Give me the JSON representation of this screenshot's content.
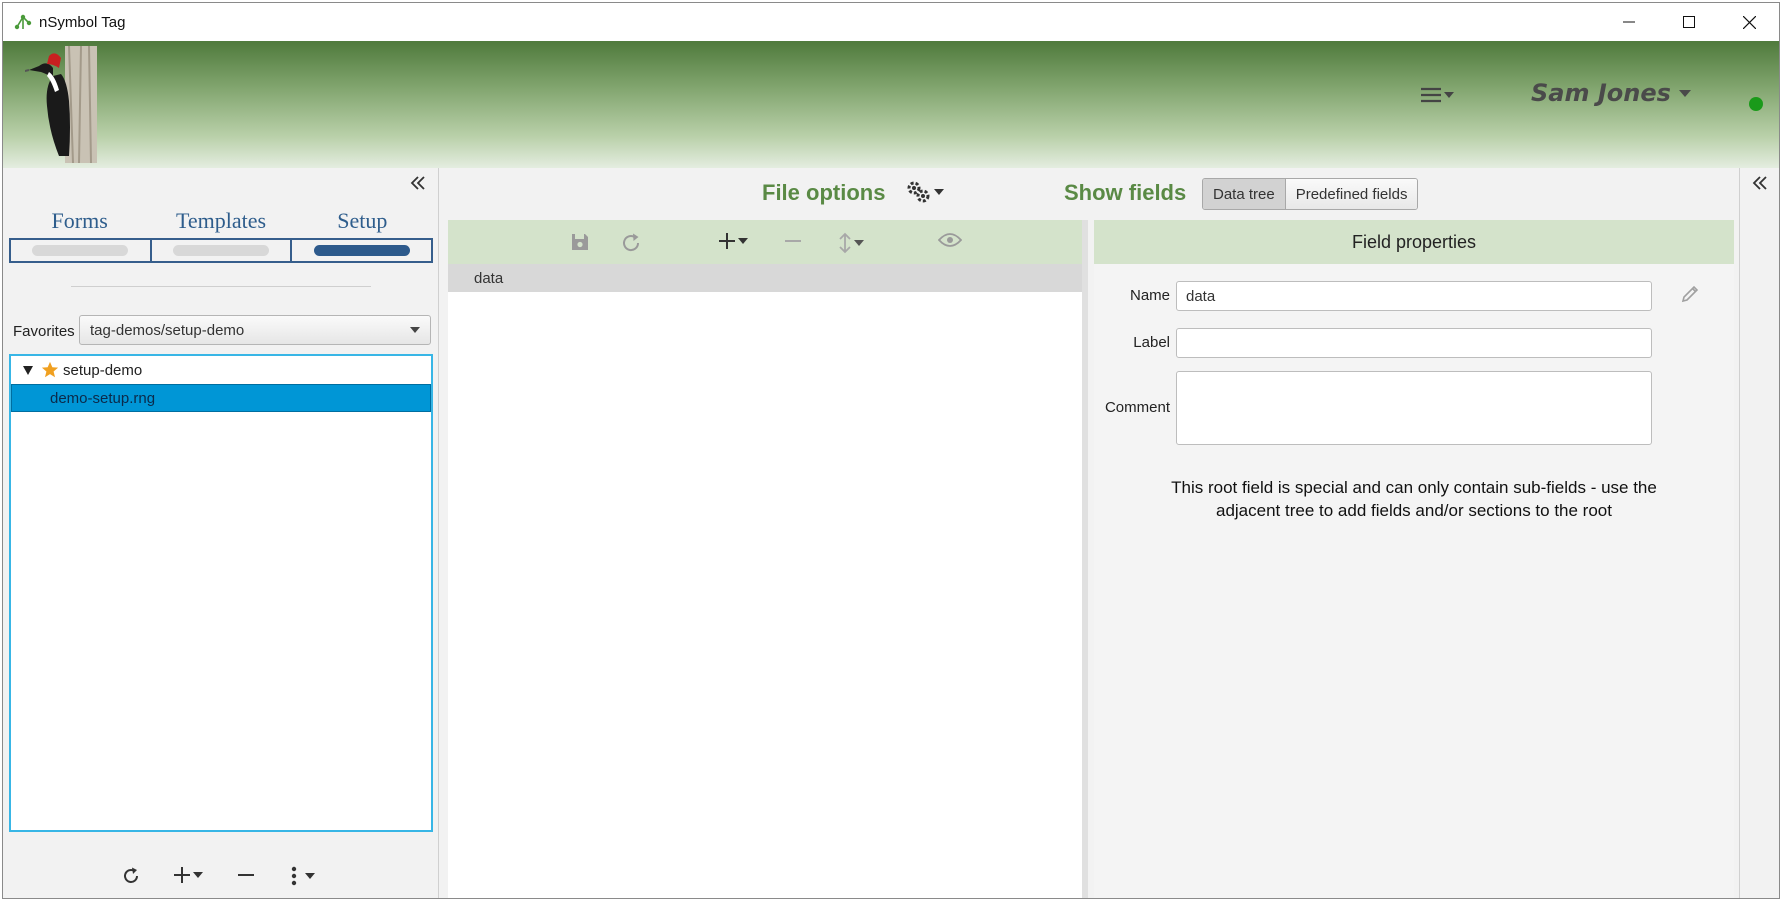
{
  "window": {
    "title": "nSymbol Tag"
  },
  "banner": {
    "user_name": "Sam Jones"
  },
  "left_panel": {
    "tabs": [
      {
        "label": "Forms",
        "active": false
      },
      {
        "label": "Templates",
        "active": false
      },
      {
        "label": "Setup",
        "active": true
      }
    ],
    "favorites_label": "Favorites",
    "favorites_value": "tag-demos/setup-demo",
    "tree": {
      "folder": "setup-demo",
      "file": "demo-setup.rng"
    }
  },
  "center": {
    "file_options_label": "File options",
    "show_fields_label": "Show fields",
    "show_fields_options": [
      "Data tree",
      "Predefined fields"
    ],
    "show_fields_selected": "Data tree",
    "tree_root": "data",
    "field_properties": {
      "title": "Field properties",
      "name_label": "Name",
      "name_value": "data",
      "label_label": "Label",
      "label_value": "",
      "comment_label": "Comment",
      "comment_value": "",
      "note_line1": "This root field is special and can only contain sub-fields - use the",
      "note_line2": "adjacent tree to add fields and/or sections to the root"
    }
  },
  "colors": {
    "accent_green": "#5a8a45",
    "tab_blue": "#2e5d8c",
    "selection_blue": "#0096d6",
    "status_online": "#1a9a1a"
  },
  "icons": [
    "app-icon",
    "minimize-icon",
    "maximize-icon",
    "close-icon",
    "woodpecker-logo",
    "hamburger-menu-icon",
    "caret-down-icon",
    "double-chevron-left-icon",
    "star-icon",
    "expand-triangle-icon",
    "refresh-icon",
    "plus-icon",
    "minus-icon",
    "kebab-icon",
    "save-icon",
    "reload-icon",
    "move-arrows-icon",
    "eye-icon",
    "gears-icon",
    "pencil-icon"
  ]
}
